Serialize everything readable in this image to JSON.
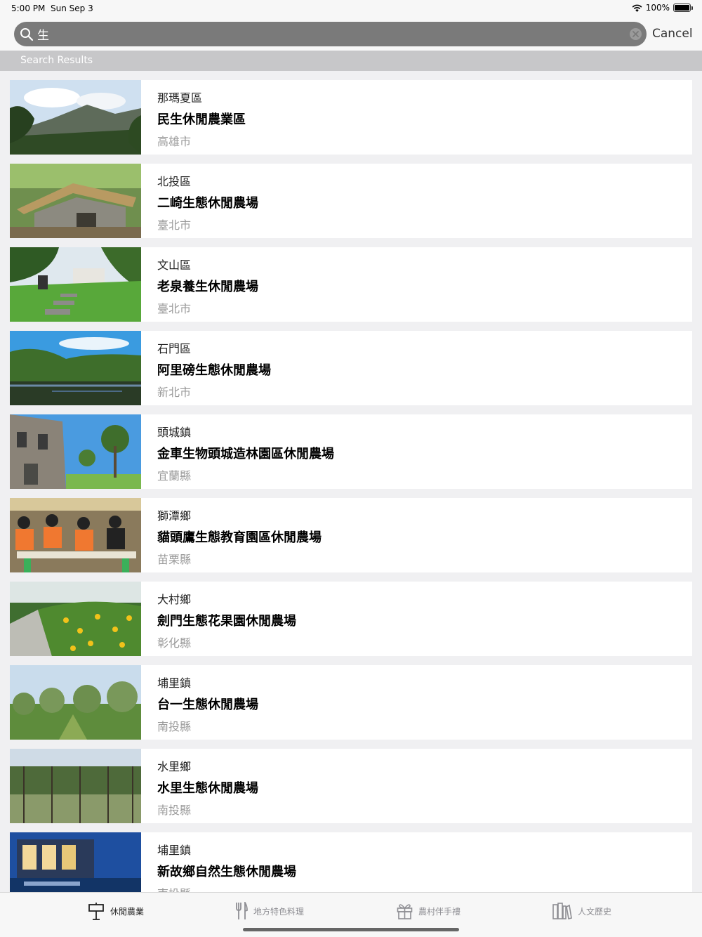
{
  "status": {
    "time": "5:00 PM",
    "date": "Sun Sep 3",
    "battery": "100%"
  },
  "search": {
    "value": "生",
    "cancel_label": "Cancel"
  },
  "section": {
    "title": "Search Results"
  },
  "results": [
    {
      "district": "那瑪夏區",
      "name": "民生休閒農業區",
      "city": "高雄市",
      "thumb": "mountain-valley"
    },
    {
      "district": "北投區",
      "name": "二崎生態休閒農場",
      "city": "臺北市",
      "thumb": "stone-hut"
    },
    {
      "district": "文山區",
      "name": "老泉養生休閒農場",
      "city": "臺北市",
      "thumb": "garden-path"
    },
    {
      "district": "石門區",
      "name": "阿里磅生態休閒農場",
      "city": "新北市",
      "thumb": "lake-forest"
    },
    {
      "district": "頭城鎮",
      "name": "金車生物頭城造林園區休閒農場",
      "city": "宜蘭縣",
      "thumb": "building-trees"
    },
    {
      "district": "獅潭鄉",
      "name": "貓頭鷹生態教育園區休閒農場",
      "city": "苗栗縣",
      "thumb": "students"
    },
    {
      "district": "大村鄉",
      "name": "劍門生態花果園休閒農場",
      "city": "彰化縣",
      "thumb": "flowers"
    },
    {
      "district": "埔里鎮",
      "name": "台一生態休閒農場",
      "city": "南投縣",
      "thumb": "orchard"
    },
    {
      "district": "水里鄉",
      "name": "水里生態休閒農場",
      "city": "南投縣",
      "thumb": "vineyard"
    },
    {
      "district": "埔里鎮",
      "name": "新故鄉自然生態休閒農場",
      "city": "南投縣",
      "thumb": "night-building"
    }
  ],
  "tabs": [
    {
      "label": "休閒農業",
      "icon": "farm-sign-icon",
      "active": true
    },
    {
      "label": "地方特色料理",
      "icon": "fork-knife-icon",
      "active": false
    },
    {
      "label": "農村伴手禮",
      "icon": "gift-icon",
      "active": false
    },
    {
      "label": "人文歷史",
      "icon": "books-icon",
      "active": false
    }
  ]
}
